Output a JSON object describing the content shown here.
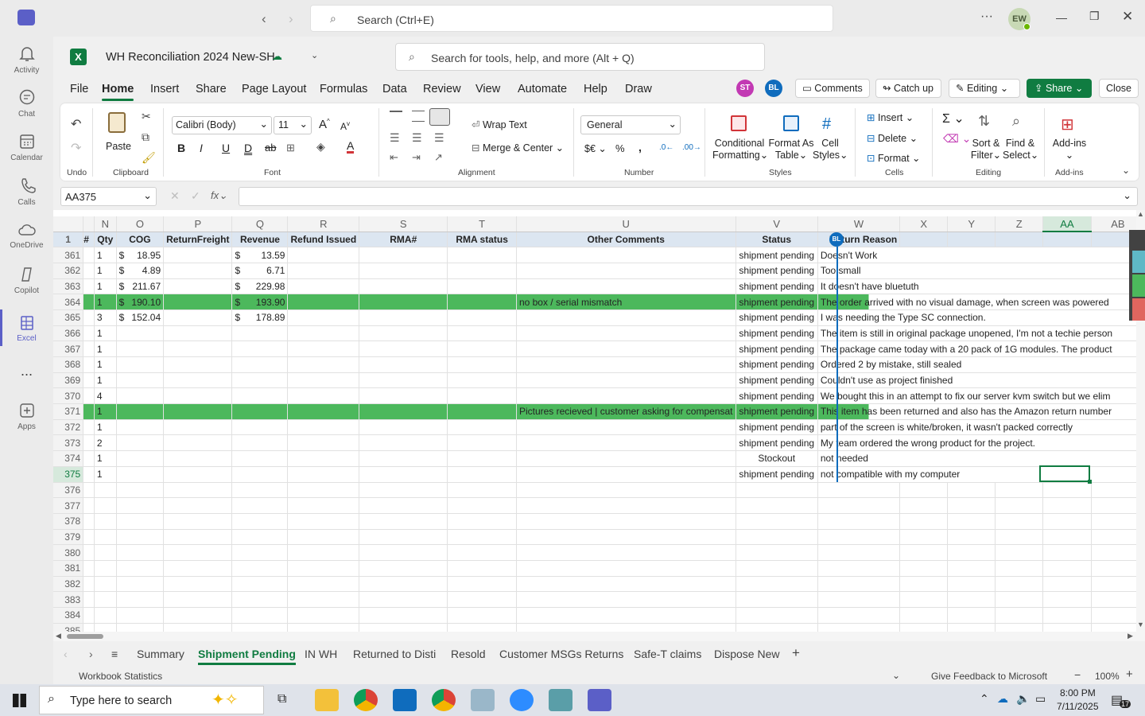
{
  "teams": {
    "search_placeholder": "Search (Ctrl+E)",
    "avatar": "EW"
  },
  "rail": [
    {
      "label": "Activity",
      "icon": "bell-icon"
    },
    {
      "label": "Chat",
      "icon": "chat-icon"
    },
    {
      "label": "Calendar",
      "icon": "calendar-icon"
    },
    {
      "label": "Calls",
      "icon": "phone-icon"
    },
    {
      "label": "OneDrive",
      "icon": "cloud-icon"
    },
    {
      "label": "Copilot",
      "icon": "copilot-icon"
    },
    {
      "label": "Excel",
      "icon": "excel-icon"
    },
    {
      "label": "...",
      "icon": "more-icon"
    },
    {
      "label": "Apps",
      "icon": "apps-icon"
    }
  ],
  "workbook": {
    "title": "WH Reconciliation 2024 New-SH",
    "tools_search": "Search for tools, help, and more (Alt + Q)"
  },
  "menu_tabs": [
    "File",
    "Home",
    "Insert",
    "Share",
    "Page Layout",
    "Formulas",
    "Data",
    "Review",
    "View",
    "Automate",
    "Help",
    "Draw"
  ],
  "collab": {
    "avatar1": "ST",
    "avatar2": "BL",
    "comments": "Comments",
    "catchup": "Catch up",
    "editing": "Editing",
    "share": "Share",
    "close": "Close"
  },
  "ribbon": {
    "undo": "Undo",
    "paste": "Paste",
    "clipboard": "Clipboard",
    "font_name": "Calibri (Body)",
    "font_size": "11",
    "font": "Font",
    "wrap": "Wrap Text",
    "merge": "Merge & Center",
    "alignment": "Alignment",
    "numfmt": "General",
    "number": "Number",
    "cond1": "Conditional",
    "cond2": "Formatting",
    "fmt1": "Format As",
    "fmt2": "Table",
    "cell1": "Cell",
    "cell2": "Styles",
    "styles": "Styles",
    "insert": "Insert",
    "delete": "Delete",
    "format": "Format",
    "cells": "Cells",
    "sort1": "Sort &",
    "sort2": "Filter",
    "find1": "Find &",
    "find2": "Select",
    "editing": "Editing",
    "addins": "Add-ins",
    "addins_label": "Add-ins"
  },
  "namebox": "AA375",
  "columns": [
    "N",
    "O",
    "P",
    "Q",
    "R",
    "S",
    "T",
    "U",
    "V",
    "W",
    "X",
    "Y",
    "Z",
    "AA",
    "AB"
  ],
  "header_row": {
    "num": "1",
    "cells": [
      "#",
      "Qty",
      "COG",
      "ReturnFreight",
      "Revenue",
      "Refund Issued",
      "RMA#",
      "RMA status",
      "Other Comments",
      "Status",
      "Return Reason"
    ]
  },
  "rows": [
    {
      "n": "361",
      "qty": "1",
      "cog": "18.95",
      "rev": "13.59",
      "comments": "",
      "status": "shipment pending",
      "reason": "Doesn't Work",
      "green": false
    },
    {
      "n": "362",
      "qty": "1",
      "cog": "4.89",
      "rev": "6.71",
      "comments": "",
      "status": "shipment pending",
      "reason": "Too small",
      "green": false
    },
    {
      "n": "363",
      "qty": "1",
      "cog": "211.67",
      "rev": "229.98",
      "comments": "",
      "status": "shipment pending",
      "reason": "It doesn't have bluetuth",
      "green": false
    },
    {
      "n": "364",
      "qty": "1",
      "cog": "190.10",
      "rev": "193.90",
      "comments": "no box / serial mismatch",
      "status": "shipment pending",
      "reason": "The order arrived with no visual damage, when screen was powered",
      "green": true
    },
    {
      "n": "365",
      "qty": "3",
      "cog": "152.04",
      "rev": "178.89",
      "comments": "",
      "status": "shipment pending",
      "reason": "I was needing the Type SC connection.",
      "green": false
    },
    {
      "n": "366",
      "qty": "1",
      "cog": "",
      "rev": "",
      "comments": "",
      "status": "shipment pending",
      "reason": "The item is still in original package unopened, I'm not a techie person",
      "green": false
    },
    {
      "n": "367",
      "qty": "1",
      "cog": "",
      "rev": "",
      "comments": "",
      "status": "shipment pending",
      "reason": "The package came today with a 20 pack of 1G modules.  The product",
      "green": false
    },
    {
      "n": "368",
      "qty": "1",
      "cog": "",
      "rev": "",
      "comments": "",
      "status": "shipment pending",
      "reason": "Ordered 2 by mistake, still sealed",
      "green": false
    },
    {
      "n": "369",
      "qty": "1",
      "cog": "",
      "rev": "",
      "comments": "",
      "status": "shipment pending",
      "reason": "Couldn't use as project finished",
      "green": false
    },
    {
      "n": "370",
      "qty": "4",
      "cog": "",
      "rev": "",
      "comments": "",
      "status": "shipment pending",
      "reason": "We bought this in an attempt to fix our server kvm switch but we elim",
      "green": false
    },
    {
      "n": "371",
      "qty": "1",
      "cog": "",
      "rev": "",
      "comments": "Pictures recieved | customer asking for compensat",
      "status": "shipment pending",
      "reason": "This item has been returned and also has the Amazon return number",
      "green": true
    },
    {
      "n": "372",
      "qty": "1",
      "cog": "",
      "rev": "",
      "comments": "",
      "status": "shipment pending",
      "reason": "part of the screen is white/broken, it wasn't packed correctly",
      "green": false
    },
    {
      "n": "373",
      "qty": "2",
      "cog": "",
      "rev": "",
      "comments": "",
      "status": "shipment pending",
      "reason": "My team ordered the wrong product for the project.",
      "green": false
    },
    {
      "n": "374",
      "qty": "1",
      "cog": "",
      "rev": "",
      "comments": "",
      "status": "Stockout",
      "reason": "not needed",
      "green": false
    },
    {
      "n": "375",
      "qty": "1",
      "cog": "",
      "rev": "",
      "comments": "",
      "status": "shipment pending",
      "reason": "not compatible with my computer",
      "green": false
    }
  ],
  "empty_rows": [
    "376",
    "377",
    "378",
    "379",
    "380",
    "381",
    "382",
    "383",
    "384",
    "385"
  ],
  "sheet_tabs": [
    "Summary",
    "Shipment Pending",
    "IN WH",
    "Returned to Disti",
    "Resold",
    "Customer MSGs Returns",
    "Safe-T claims",
    "Dispose New"
  ],
  "status": {
    "stats": "Workbook Statistics",
    "feedback": "Give Feedback to Microsoft",
    "zoom": "100%"
  },
  "taskbar": {
    "search": "Type here to search",
    "time": "8:00 PM",
    "date": "7/11/2025",
    "notif": "17"
  }
}
